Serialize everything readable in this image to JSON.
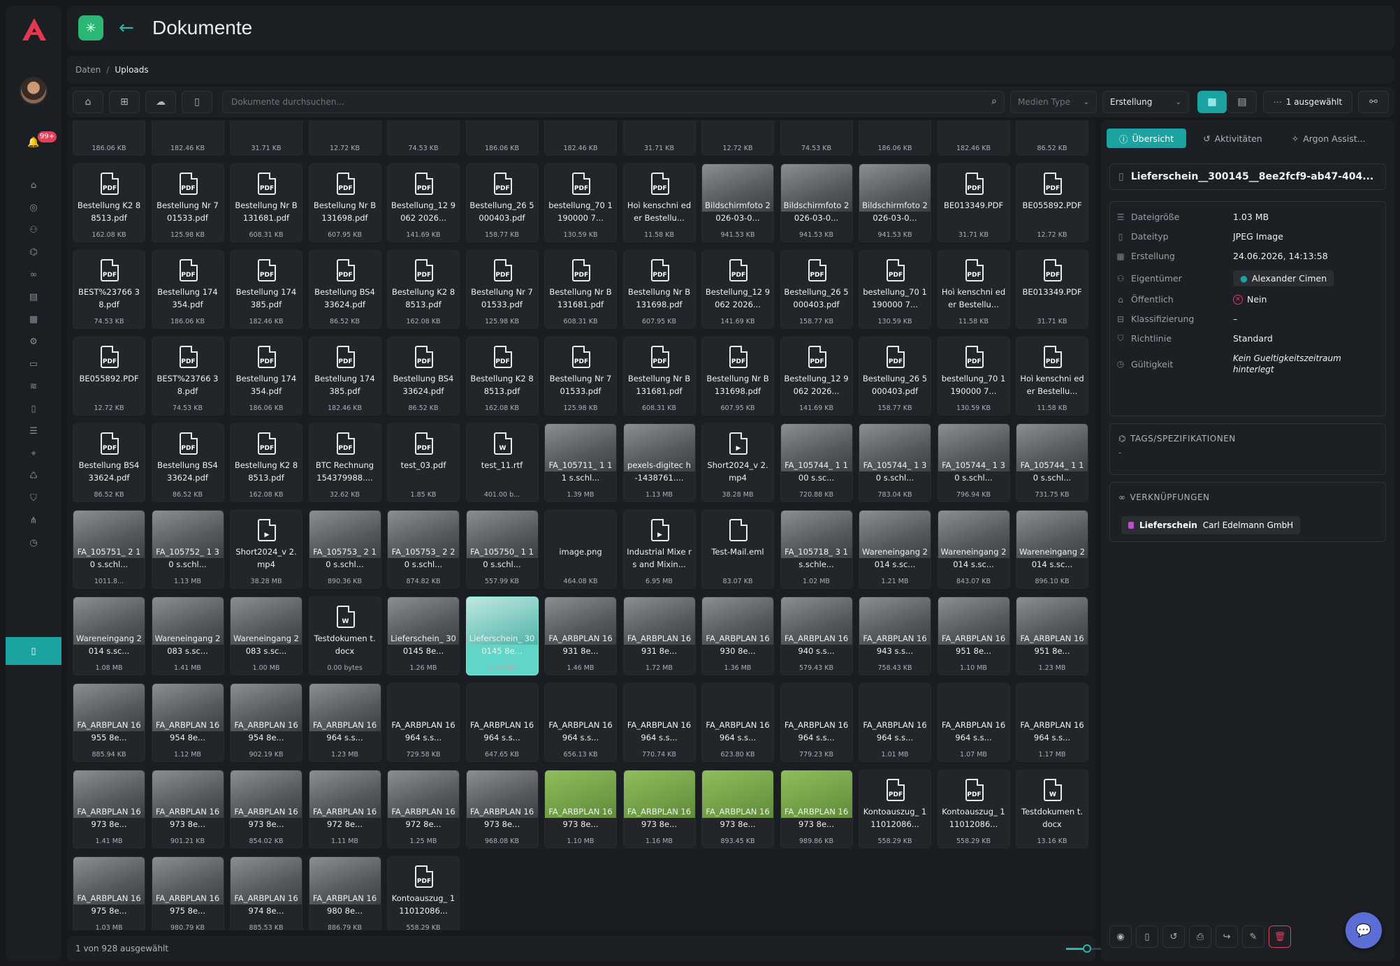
{
  "header": {
    "title": "Dokumente"
  },
  "breadcrumb": {
    "items": [
      "Daten",
      "Uploads"
    ],
    "separator": "/"
  },
  "toolbar": {
    "search_placeholder": "Dokumente durchsuchen...",
    "media_type": "Medien Type",
    "sort": "Erstellung",
    "selected_label": "1 ausgewählt"
  },
  "notifications": {
    "count": "99+"
  },
  "status": {
    "text": "1 von 928 ausgewählt"
  },
  "tiles": [
    {
      "kind": "pdf",
      "name": "",
      "size": "186.06 KB"
    },
    {
      "kind": "pdf",
      "name": "",
      "size": "182.46 KB"
    },
    {
      "kind": "pdf",
      "name": "",
      "size": "31.71 KB"
    },
    {
      "kind": "pdf",
      "name": "",
      "size": "12.72 KB"
    },
    {
      "kind": "pdf",
      "name": "",
      "size": "74.53 KB"
    },
    {
      "kind": "pdf",
      "name": "",
      "size": "186.06 KB"
    },
    {
      "kind": "pdf",
      "name": "",
      "size": "182.46 KB"
    },
    {
      "kind": "pdf",
      "name": "",
      "size": "31.71 KB"
    },
    {
      "kind": "pdf",
      "name": "",
      "size": "12.72 KB"
    },
    {
      "kind": "pdf",
      "name": "",
      "size": "74.53 KB"
    },
    {
      "kind": "pdf",
      "name": "",
      "size": "186.06 KB"
    },
    {
      "kind": "pdf",
      "name": "",
      "size": "182.46 KB"
    },
    {
      "kind": "pdf",
      "name": "",
      "size": "86.52 KB"
    },
    {
      "kind": "pdf",
      "name": "Bestellung K2 88513.pdf",
      "size": "162.08 KB"
    },
    {
      "kind": "pdf",
      "name": "Bestellung Nr 701533.pdf",
      "size": "125.98 KB"
    },
    {
      "kind": "pdf",
      "name": "Bestellung Nr B131681.pdf",
      "size": "608.31 KB"
    },
    {
      "kind": "pdf",
      "name": "Bestellung Nr B131698.pdf",
      "size": "607.95 KB"
    },
    {
      "kind": "pdf",
      "name": "Bestellung_12 9062 2026...",
      "size": "141.69 KB"
    },
    {
      "kind": "pdf",
      "name": "Bestellung_26 5000403.pdf",
      "size": "158.77 KB"
    },
    {
      "kind": "pdf",
      "name": "bestellung_70 1190000 7...",
      "size": "130.59 KB"
    },
    {
      "kind": "pdf",
      "name": "Hoì kenschni eder Bestellu...",
      "size": "11.58 KB"
    },
    {
      "kind": "img",
      "name": "Bildschirmfoto 2026-03-0...",
      "size": "941.53 KB"
    },
    {
      "kind": "img",
      "name": "Bildschirmfoto 2026-03-0...",
      "size": "941.53 KB"
    },
    {
      "kind": "img",
      "name": "Bildschirmfoto 2026-03-0...",
      "size": "941.53 KB"
    },
    {
      "kind": "pdf",
      "name": "BE013349.PDF",
      "size": "31.71 KB"
    },
    {
      "kind": "pdf",
      "name": "BE055892.PDF",
      "size": "12.72 KB"
    },
    {
      "kind": "pdf",
      "name": "BEST%23766 38.pdf",
      "size": "74.53 KB"
    },
    {
      "kind": "pdf",
      "name": "Bestellung 174 354.pdf",
      "size": "186.06 KB"
    },
    {
      "kind": "pdf",
      "name": "Bestellung 174 385.pdf",
      "size": "182.46 KB"
    },
    {
      "kind": "pdf",
      "name": "Bestellung BS4 33624.pdf",
      "size": "86.52 KB"
    },
    {
      "kind": "pdf",
      "name": "Bestellung K2 88513.pdf",
      "size": "162.08 KB"
    },
    {
      "kind": "pdf",
      "name": "Bestellung Nr 701533.pdf",
      "size": "125.98 KB"
    },
    {
      "kind": "pdf",
      "name": "Bestellung Nr B131681.pdf",
      "size": "608.31 KB"
    },
    {
      "kind": "pdf",
      "name": "Bestellung Nr B131698.pdf",
      "size": "607.95 KB"
    },
    {
      "kind": "pdf",
      "name": "Bestellung_12 9062 2026...",
      "size": "141.69 KB"
    },
    {
      "kind": "pdf",
      "name": "Bestellung_26 5000403.pdf",
      "size": "158.77 KB"
    },
    {
      "kind": "pdf",
      "name": "bestellung_70 1190000 7...",
      "size": "130.59 KB"
    },
    {
      "kind": "pdf",
      "name": "Hoì kenschni eder Bestellu...",
      "size": "11.58 KB"
    },
    {
      "kind": "pdf",
      "name": "BE013349.PDF",
      "size": "31.71 KB"
    },
    {
      "kind": "pdf",
      "name": "BE055892.PDF",
      "size": "12.72 KB"
    },
    {
      "kind": "pdf",
      "name": "BEST%23766 38.pdf",
      "size": "74.53 KB"
    },
    {
      "kind": "pdf",
      "name": "Bestellung 174 354.pdf",
      "size": "186.06 KB"
    },
    {
      "kind": "pdf",
      "name": "Bestellung 174 385.pdf",
      "size": "182.46 KB"
    },
    {
      "kind": "pdf",
      "name": "Bestellung BS4 33624.pdf",
      "size": "86.52 KB"
    },
    {
      "kind": "pdf",
      "name": "Bestellung K2 88513.pdf",
      "size": "162.08 KB"
    },
    {
      "kind": "pdf",
      "name": "Bestellung Nr 701533.pdf",
      "size": "125.98 KB"
    },
    {
      "kind": "pdf",
      "name": "Bestellung Nr B131681.pdf",
      "size": "608.31 KB"
    },
    {
      "kind": "pdf",
      "name": "Bestellung Nr B131698.pdf",
      "size": "607.95 KB"
    },
    {
      "kind": "pdf",
      "name": "Bestellung_12 9062 2026...",
      "size": "141.69 KB"
    },
    {
      "kind": "pdf",
      "name": "Bestellung_26 5000403.pdf",
      "size": "158.77 KB"
    },
    {
      "kind": "pdf",
      "name": "bestellung_70 1190000 7...",
      "size": "130.59 KB"
    },
    {
      "kind": "pdf",
      "name": "Hoì kenschni eder Bestellu...",
      "size": "11.58 KB"
    },
    {
      "kind": "pdf",
      "name": "Bestellung BS4 33624.pdf",
      "size": "86.52 KB"
    },
    {
      "kind": "pdf",
      "name": "Bestellung BS4 33624.pdf",
      "size": "86.52 KB"
    },
    {
      "kind": "pdf",
      "name": "Bestellung K2 88513.pdf",
      "size": "162.08 KB"
    },
    {
      "kind": "pdf",
      "name": "BTC Rechnung 154379988....",
      "size": "32.62 KB"
    },
    {
      "kind": "pdf",
      "name": "test_03.pdf",
      "size": "1.85 KB"
    },
    {
      "kind": "doc",
      "name": "test_11.rtf",
      "size": "401.00 b..."
    },
    {
      "kind": "img",
      "name": "FA_105711_ 1 11 s.schl...",
      "size": "1.39 MB"
    },
    {
      "kind": "img",
      "name": "pexels-digitec h-1438761....",
      "size": "1.13 MB"
    },
    {
      "kind": "vid",
      "name": "Short2024_v 2.mp4",
      "size": "38.28 MB"
    },
    {
      "kind": "img",
      "name": "FA_105744_ 1 100 s.sc...",
      "size": "720.88 KB"
    },
    {
      "kind": "img",
      "name": "FA_105744_ 1 30 s.schl...",
      "size": "783.04 KB"
    },
    {
      "kind": "img",
      "name": "FA_105744_ 1 30 s.schl...",
      "size": "796.94 KB"
    },
    {
      "kind": "img",
      "name": "FA_105744_ 1 10 s.schl...",
      "size": "731.75 KB"
    },
    {
      "kind": "img",
      "name": "FA_105751_ 2 10 s.schl...",
      "size": "1011.8..."
    },
    {
      "kind": "img",
      "name": "FA_105752_ 1 30 s.schl...",
      "size": "1.13 MB"
    },
    {
      "kind": "vid",
      "name": "Short2024_v 2.mp4",
      "size": "38.28 MB"
    },
    {
      "kind": "img",
      "name": "FA_105753_ 2 10 s.schl...",
      "size": "890.36 KB"
    },
    {
      "kind": "img",
      "name": "FA_105753_ 2 20 s.schl...",
      "size": "874.82 KB"
    },
    {
      "kind": "img",
      "name": "FA_105750_ 1 10 s.schl...",
      "size": "557.99 KB"
    },
    {
      "kind": "blank",
      "name": "image.png",
      "size": "464.08 KB"
    },
    {
      "kind": "vid",
      "name": "Industrial Mixe rs and Mixin...",
      "size": "6.95 MB"
    },
    {
      "kind": "file",
      "name": "Test-Mail.eml",
      "size": "83.07 KB"
    },
    {
      "kind": "img",
      "name": "FA_105718_ 3 1 s.schle...",
      "size": "1.02 MB"
    },
    {
      "kind": "img",
      "name": "Wareneingang 2014 s.sc...",
      "size": "1.21 MB"
    },
    {
      "kind": "img",
      "name": "Wareneingang 2014 s.sc...",
      "size": "843.07 KB"
    },
    {
      "kind": "img",
      "name": "Wareneingang 2014 s.sc...",
      "size": "896.10 KB"
    },
    {
      "kind": "img",
      "name": "Wareneingang 2014 s.sc...",
      "size": "1.08 MB"
    },
    {
      "kind": "img",
      "name": "Wareneingang 2083 s.sc...",
      "size": "1.41 MB"
    },
    {
      "kind": "img",
      "name": "Wareneingang 2083 s.sc...",
      "size": "1.00 MB"
    },
    {
      "kind": "doc",
      "name": "Testdokumen t.docx",
      "size": "0.00 bytes"
    },
    {
      "kind": "img",
      "name": "Lieferschein_ 300145 8e...",
      "size": "1.26 MB"
    },
    {
      "kind": "sel",
      "name": "Lieferschein_ 300145 8e...",
      "size": "1.03 MB"
    },
    {
      "kind": "img",
      "name": "FA_ARBPLAN 16931 8e...",
      "size": "1.46 MB"
    },
    {
      "kind": "img",
      "name": "FA_ARBPLAN 16931 8e...",
      "size": "1.72 MB"
    },
    {
      "kind": "img",
      "name": "FA_ARBPLAN 16930 8e...",
      "size": "1.36 MB"
    },
    {
      "kind": "img",
      "name": "FA_ARBPLAN 16940 s.s...",
      "size": "579.43 KB"
    },
    {
      "kind": "img",
      "name": "FA_ARBPLAN 16943 s.s...",
      "size": "758.43 KB"
    },
    {
      "kind": "img",
      "name": "FA_ARBPLAN 16951 8e...",
      "size": "1.10 MB"
    },
    {
      "kind": "img",
      "name": "FA_ARBPLAN 16951 8e...",
      "size": "1.23 MB"
    },
    {
      "kind": "img",
      "name": "FA_ARBPLAN 16955 8e...",
      "size": "885.94 KB"
    },
    {
      "kind": "img",
      "name": "FA_ARBPLAN 16954 8e...",
      "size": "1.12 MB"
    },
    {
      "kind": "img",
      "name": "FA_ARBPLAN 16954 8e...",
      "size": "902.19 KB"
    },
    {
      "kind": "img",
      "name": "FA_ARBPLAN 16964 s.s...",
      "size": "1.23 MB"
    },
    {
      "kind": "blank",
      "name": "FA_ARBPLAN 16964 s.s...",
      "size": "729.58 KB"
    },
    {
      "kind": "blank",
      "name": "FA_ARBPLAN 16964 s.s...",
      "size": "647.65 KB"
    },
    {
      "kind": "blank",
      "name": "FA_ARBPLAN 16964 s.s...",
      "size": "656.13 KB"
    },
    {
      "kind": "blank",
      "name": "FA_ARBPLAN 16964 s.s...",
      "size": "770.74 KB"
    },
    {
      "kind": "blank",
      "name": "FA_ARBPLAN 16964 s.s...",
      "size": "623.80 KB"
    },
    {
      "kind": "blank",
      "name": "FA_ARBPLAN 16964 s.s...",
      "size": "779.23 KB"
    },
    {
      "kind": "blank",
      "name": "FA_ARBPLAN 16964 s.s...",
      "size": "1.01 MB"
    },
    {
      "kind": "blank",
      "name": "FA_ARBPLAN 16964 s.s...",
      "size": "1.07 MB"
    },
    {
      "kind": "blank",
      "name": "FA_ARBPLAN 16964 s.s...",
      "size": "1.17 MB"
    },
    {
      "kind": "img",
      "name": "FA_ARBPLAN 16973 8e...",
      "size": "1.41 MB"
    },
    {
      "kind": "img",
      "name": "FA_ARBPLAN 16973 8e...",
      "size": "901.21 KB"
    },
    {
      "kind": "img",
      "name": "FA_ARBPLAN 16973 8e...",
      "size": "854.02 KB"
    },
    {
      "kind": "img",
      "name": "FA_ARBPLAN 16972 8e...",
      "size": "1.11 MB"
    },
    {
      "kind": "img",
      "name": "FA_ARBPLAN 16972 8e...",
      "size": "1.25 MB"
    },
    {
      "kind": "img",
      "name": "FA_ARBPLAN 16973 8e...",
      "size": "968.08 KB"
    },
    {
      "kind": "green",
      "name": "FA_ARBPLAN 16973 8e...",
      "size": "1.10 MB"
    },
    {
      "kind": "green",
      "name": "FA_ARBPLAN 16973 8e...",
      "size": "1.16 MB"
    },
    {
      "kind": "green",
      "name": "FA_ARBPLAN 16973 8e...",
      "size": "893.45 KB"
    },
    {
      "kind": "green",
      "name": "FA_ARBPLAN 16973 8e...",
      "size": "989.86 KB"
    },
    {
      "kind": "pdf",
      "name": "Kontoauszug_ 111012086...",
      "size": "558.29 KB"
    },
    {
      "kind": "pdf",
      "name": "Kontoauszug_ 111012086...",
      "size": "558.29 KB"
    },
    {
      "kind": "doc",
      "name": "Testdokumen t.docx",
      "size": "13.16 KB"
    },
    {
      "kind": "img",
      "name": "FA_ARBPLAN 16975 8e...",
      "size": "1.03 MB"
    },
    {
      "kind": "img",
      "name": "FA_ARBPLAN 16975 8e...",
      "size": "980.79 KB"
    },
    {
      "kind": "img",
      "name": "FA_ARBPLAN 16974 8e...",
      "size": "885.53 KB"
    },
    {
      "kind": "img",
      "name": "FA_ARBPLAN 16980 8e...",
      "size": "886.79 KB"
    },
    {
      "kind": "pdf",
      "name": "Kontoauszug_ 111012086...",
      "size": "558.29 KB"
    }
  ],
  "detail": {
    "tabs": [
      "Übersicht",
      "Aktivitäten",
      "Argon Assist..."
    ],
    "filename": "Lieferschein__300145__8ee2fcf9-ab47-404...",
    "props": [
      {
        "icon": "database-icon",
        "label": "Dateigröße",
        "value": "1.03 MB"
      },
      {
        "icon": "file-icon",
        "label": "Dateityp",
        "value": "JPEG Image"
      },
      {
        "icon": "calendar-icon",
        "label": "Erstellung",
        "value": "24.06.2026, 14:13:58"
      },
      {
        "icon": "user-icon",
        "label": "Eigentümer",
        "value": "Alexander Cimen"
      },
      {
        "icon": "lock-icon",
        "label": "Öffentlich",
        "value": "Nein"
      },
      {
        "icon": "layers-icon",
        "label": "Klassifizierung",
        "value": "–"
      },
      {
        "icon": "shield-icon",
        "label": "Richtlinie",
        "value": "Standard"
      },
      {
        "icon": "clock-icon",
        "label": "Gültigkeit",
        "value": "Kein Gueltigkeitszeitraum hinterlegt"
      }
    ],
    "tags_header": "TAGS/SPEZIFIKATIONEN",
    "tags_value": "-",
    "links_header": "VERKNÜPFUNGEN",
    "link_type": "Lieferschein",
    "link_target": "Carl Edelmann GmbH"
  },
  "colors": {
    "accent": "#1aa3a0",
    "brand_green": "#2bb673",
    "danger": "#e0405a"
  }
}
